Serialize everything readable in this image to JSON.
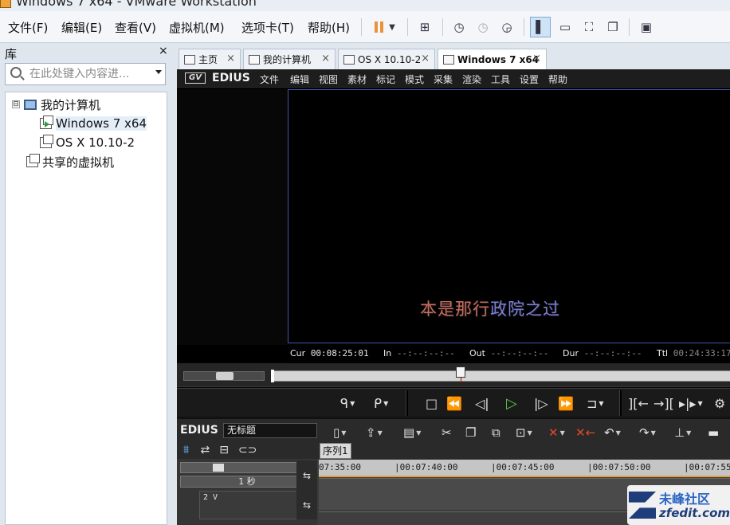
{
  "window": {
    "title": "Windows 7 x64 - VMware Workstation"
  },
  "menubar": {
    "items": [
      "文件(F)",
      "编辑(E)",
      "查看(V)",
      "虚拟机(M)",
      "选项卡(T)",
      "帮助(H)"
    ],
    "toolbar_icons": [
      "pause-icon",
      "dropdown-arrow-icon",
      "send-keys-icon",
      "snapshot-icon",
      "revert-snapshot-icon",
      "manage-snapshots-icon",
      "show-library-icon",
      "thumbnail-bar-icon",
      "full-screen-icon",
      "unity-icon",
      "console-view-icon"
    ]
  },
  "library": {
    "title": "库",
    "close": "×",
    "search_placeholder": "在此处键入内容进...",
    "tree": {
      "root_toggle": "⊟",
      "root": "我的计算机",
      "children": [
        "Windows 7 x64",
        "OS X 10.10-2"
      ],
      "shared": "共享的虚拟机"
    }
  },
  "tabs": [
    {
      "label": "主页",
      "icon": "home-icon",
      "active": false,
      "close": "×"
    },
    {
      "label": "我的计算机",
      "icon": "computer-icon",
      "active": false,
      "close": "×"
    },
    {
      "label": "OS X 10.10-2",
      "icon": "vm-icon",
      "active": false,
      "close": "×"
    },
    {
      "label": "Windows 7 x64",
      "icon": "vm-icon",
      "active": true,
      "close": "×"
    }
  ],
  "edius": {
    "logo_text": "GV",
    "brand": "EDIUS",
    "menu": [
      "文件",
      "编辑",
      "视图",
      "素材",
      "标记",
      "模式",
      "采集",
      "渲染",
      "工具",
      "设置",
      "帮助"
    ],
    "subtitle_part1": "本是那行",
    "subtitle_part2": "政院之过",
    "timecodes": {
      "cur_label": "Cur",
      "cur_value": "00:08:25:01",
      "in_label": "In",
      "in_value": "--:--:--:--",
      "out_label": "Out",
      "out_value": "--:--:--:--",
      "dur_label": "Dur",
      "dur_value": "--:--:--:--",
      "ttl_label": "Ttl",
      "ttl_value": "00:24:33:17"
    },
    "playhead_fraction": 0.41,
    "timeline": {
      "brand": "EDIUS",
      "project_name": "无标题",
      "sequence_tab": "序列1",
      "scale_label": "1 秒",
      "track_label": "2 V",
      "track_swap": "⇆",
      "ruler_ticks": [
        "07:35:00",
        "|00:07:40:00",
        "|00:07:45:00",
        "|00:07:50:00",
        "|00:07:55:"
      ]
    }
  },
  "watermark": {
    "cn": "未峰社区",
    "en": "zfedit.com"
  }
}
